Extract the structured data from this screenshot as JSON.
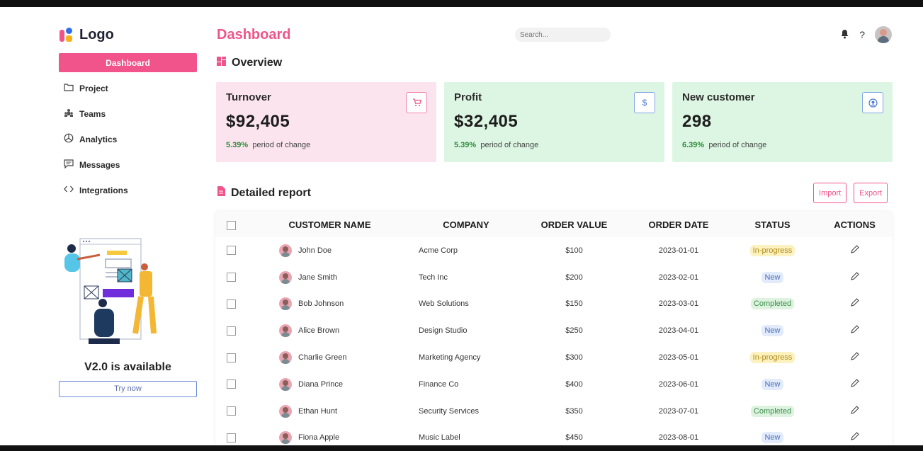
{
  "sidebar": {
    "logo_text": "Logo",
    "items": [
      {
        "label": "Dashboard",
        "icon": "none",
        "active": true
      },
      {
        "label": "Project",
        "icon": "folder-icon"
      },
      {
        "label": "Teams",
        "icon": "teams-icon"
      },
      {
        "label": "Analytics",
        "icon": "pie-chart-icon"
      },
      {
        "label": "Messages",
        "icon": "message-icon"
      },
      {
        "label": "Integrations",
        "icon": "code-icon"
      }
    ],
    "promo": {
      "title": "V2.0 is available",
      "button": "Try now"
    }
  },
  "header": {
    "title": "Dashboard",
    "search_placeholder": "Search...",
    "icons": [
      "bell-icon",
      "help-icon",
      "avatar"
    ]
  },
  "overview": {
    "title": "Overview",
    "cards": [
      {
        "label": "Turnover",
        "value": "$92,405",
        "change": "5.39%",
        "change_text": "period of change",
        "icon": "cart-icon",
        "icon_glyph": "🛒",
        "color": "pink"
      },
      {
        "label": "Profit",
        "value": "$32,405",
        "change": "5.39%",
        "change_text": "period of change",
        "icon": "dollar-icon",
        "icon_glyph": "$",
        "color": "green"
      },
      {
        "label": "New customer",
        "value": "298",
        "change": "6.39%",
        "change_text": "period of change",
        "icon": "user-circle-icon",
        "icon_glyph": "◉",
        "color": "green"
      }
    ]
  },
  "report": {
    "title": "Detailed report",
    "import_label": "Import",
    "export_label": "Export",
    "columns": [
      "CUSTOMER NAME",
      "COMPANY",
      "ORDER VALUE",
      "ORDER DATE",
      "STATUS",
      "ACTIONS"
    ],
    "rows": [
      {
        "name": "John Doe",
        "company": "Acme Corp",
        "value": "$100",
        "date": "2023-01-01",
        "status": "In-progress"
      },
      {
        "name": "Jane Smith",
        "company": "Tech Inc",
        "value": "$200",
        "date": "2023-02-01",
        "status": "New"
      },
      {
        "name": "Bob Johnson",
        "company": "Web Solutions",
        "value": "$150",
        "date": "2023-03-01",
        "status": "Completed"
      },
      {
        "name": "Alice Brown",
        "company": "Design Studio",
        "value": "$250",
        "date": "2023-04-01",
        "status": "New"
      },
      {
        "name": "Charlie Green",
        "company": "Marketing Agency",
        "value": "$300",
        "date": "2023-05-01",
        "status": "In-progress"
      },
      {
        "name": "Diana Prince",
        "company": "Finance Co",
        "value": "$400",
        "date": "2023-06-01",
        "status": "New"
      },
      {
        "name": "Ethan Hunt",
        "company": "Security Services",
        "value": "$350",
        "date": "2023-07-01",
        "status": "Completed"
      },
      {
        "name": "Fiona Apple",
        "company": "Music Label",
        "value": "$450",
        "date": "2023-08-01",
        "status": "New"
      }
    ]
  },
  "colors": {
    "accent": "#f0548a",
    "card_pink": "#fce4ef",
    "card_green": "#ddf6e3"
  }
}
